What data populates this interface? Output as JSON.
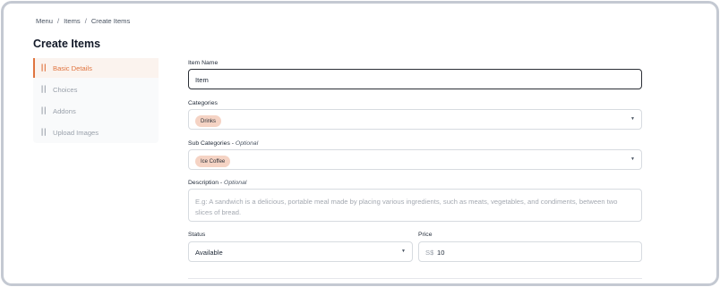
{
  "breadcrumb": {
    "items": [
      "Menu",
      "Items",
      "Create Items"
    ],
    "separator": "/"
  },
  "page": {
    "title": "Create Items"
  },
  "sidebar": {
    "items": [
      {
        "label": "Basic Details",
        "icon": "utensils-icon",
        "active": true
      },
      {
        "label": "Choices",
        "icon": "utensils-icon",
        "active": false
      },
      {
        "label": "Addons",
        "icon": "utensils-icon",
        "active": false
      },
      {
        "label": "Upload Images",
        "icon": "utensils-icon",
        "active": false
      }
    ]
  },
  "form": {
    "item_name": {
      "label": "Item Name",
      "value": "Item"
    },
    "categories": {
      "label": "Categories",
      "selected": [
        "Drinks"
      ]
    },
    "sub_categories": {
      "label": "Sub Categories",
      "optional": "Optional",
      "selected": [
        "Ice Coffee"
      ]
    },
    "description": {
      "label": "Description",
      "optional": "Optional",
      "placeholder": "E.g: A sandwich is a delicious, portable meal made by placing various ingredients, such as meats, vegetables, and condiments, between two slices of bread."
    },
    "status": {
      "label": "Status",
      "value": "Available"
    },
    "price": {
      "label": "Price",
      "currency": "S$",
      "value": "10"
    },
    "dash": "-"
  },
  "colors": {
    "accent": "#e0743f",
    "chip": "#f5d3c4",
    "frame": "#c4c9d2"
  }
}
